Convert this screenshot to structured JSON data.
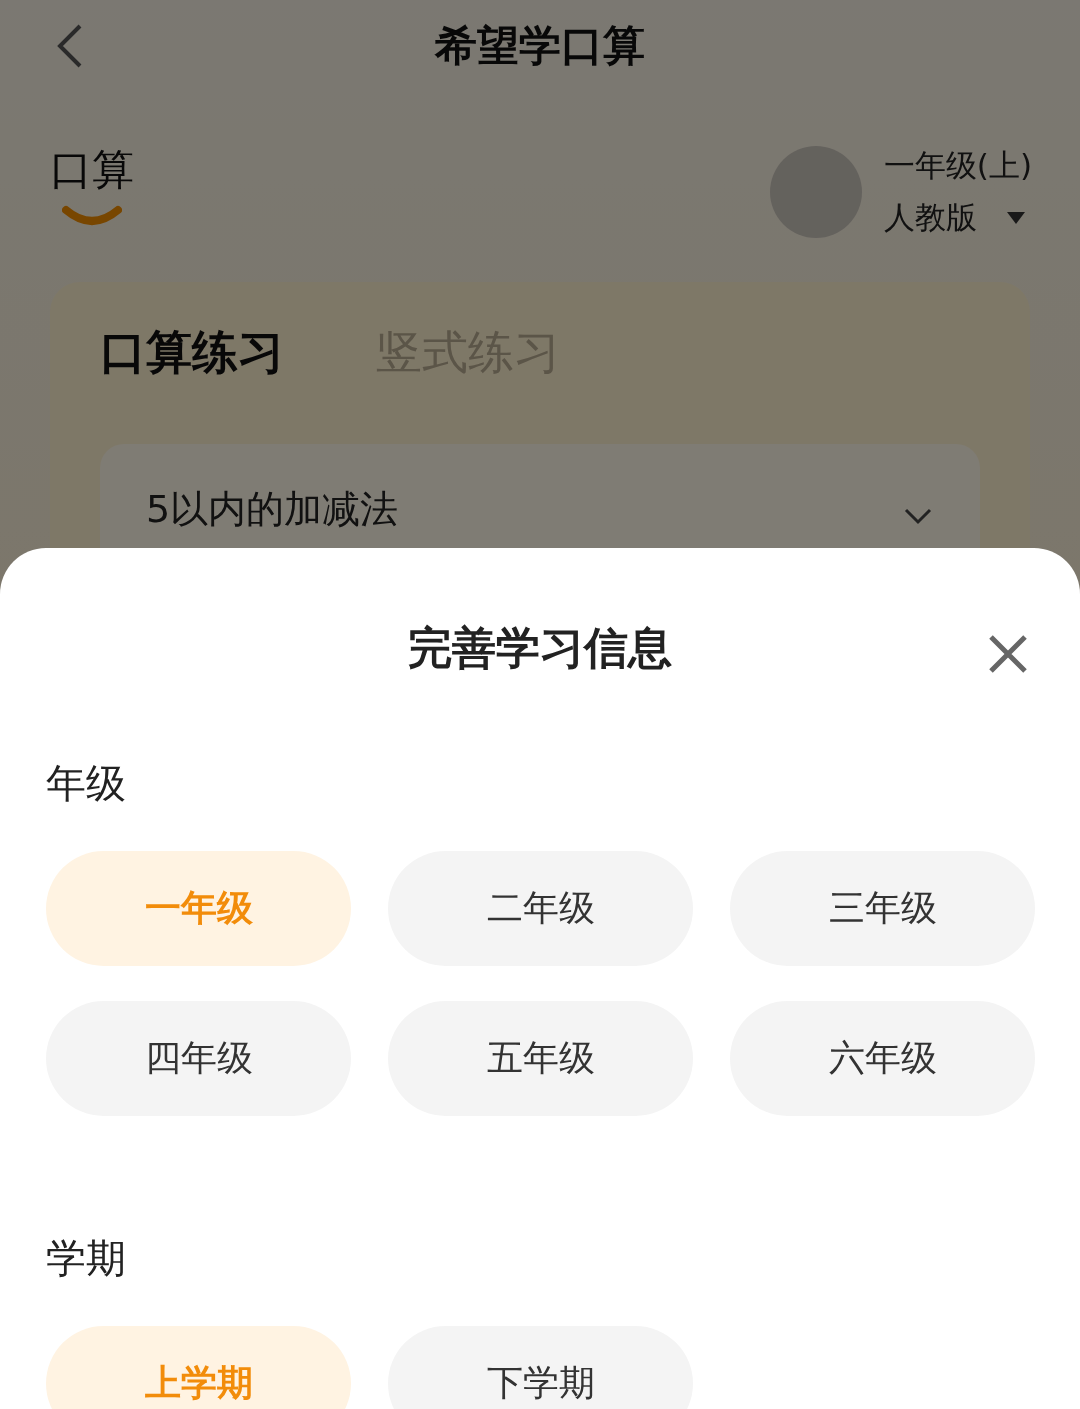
{
  "header": {
    "title": "希望学口算"
  },
  "subject_tab": {
    "label": "口算"
  },
  "profile": {
    "grade": "一年级(上)",
    "edition": "人教版"
  },
  "practice_tabs": [
    {
      "label": "口算练习",
      "selected": true
    },
    {
      "label": "竖式练习",
      "selected": false
    }
  ],
  "topic_select": {
    "value": "5以内的加减法"
  },
  "sheet": {
    "title": "完善学习信息",
    "sections": [
      {
        "label": "年级",
        "options": [
          {
            "label": "一年级",
            "selected": true
          },
          {
            "label": "二年级",
            "selected": false
          },
          {
            "label": "三年级",
            "selected": false
          },
          {
            "label": "四年级",
            "selected": false
          },
          {
            "label": "五年级",
            "selected": false
          },
          {
            "label": "六年级",
            "selected": false
          }
        ]
      },
      {
        "label": "学期",
        "options": [
          {
            "label": "上学期",
            "selected": true
          },
          {
            "label": "下学期",
            "selected": false
          }
        ]
      }
    ]
  }
}
